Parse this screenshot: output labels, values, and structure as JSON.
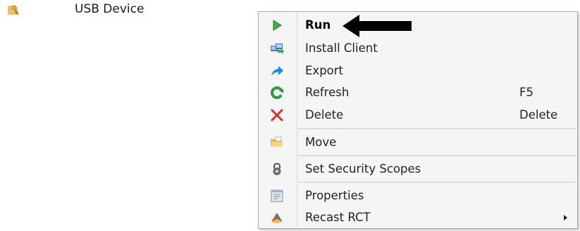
{
  "list": {
    "row_label": "USB Device",
    "row_icon": "key-folder-icon"
  },
  "menu": {
    "items": [
      {
        "label": "Run",
        "icon": "play-icon",
        "bold": true
      },
      {
        "label": "Install Client",
        "icon": "install-client-icon"
      },
      {
        "label": "Export",
        "icon": "export-arrow-icon"
      },
      {
        "label": "Refresh",
        "icon": "refresh-icon",
        "shortcut": "F5"
      },
      {
        "label": "Delete",
        "icon": "delete-x-icon",
        "shortcut": "Delete"
      },
      {
        "label": "Move",
        "icon": "folder-move-icon"
      },
      {
        "label": "Set Security Scopes",
        "icon": "lock-icon"
      },
      {
        "label": "Properties",
        "icon": "properties-icon"
      },
      {
        "label": "Recast RCT",
        "icon": "recast-icon",
        "has_submenu": true
      }
    ]
  },
  "annotation": {
    "arrow_icon": "pointer-arrow-icon",
    "color": "#000000"
  },
  "colors": {
    "run_green": "#3cb043",
    "export_blue": "#1e88e5",
    "delete_red": "#d32f2f",
    "refresh_green": "#2e9d3a",
    "folder_yellow": "#e9b949"
  }
}
